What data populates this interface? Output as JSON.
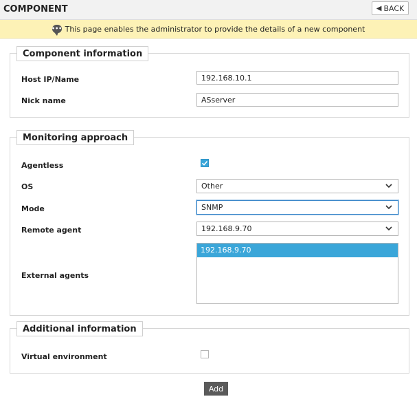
{
  "header": {
    "title": "COMPONENT",
    "back_label": "BACK"
  },
  "notice": {
    "text": "This page enables the administrator to provide the details of a new component"
  },
  "component_info": {
    "legend": "Component information",
    "host_label": "Host IP/Name",
    "host_value": "192.168.10.1",
    "nick_label": "Nick name",
    "nick_value": "ASserver"
  },
  "monitoring": {
    "legend": "Monitoring approach",
    "agentless_label": "Agentless",
    "agentless_checked": true,
    "os_label": "OS",
    "os_value": "Other",
    "mode_label": "Mode",
    "mode_value": "SNMP",
    "remote_label": "Remote agent",
    "remote_value": "192.168.9.70",
    "external_label": "External agents",
    "external_options": [
      "192.168.9.70"
    ]
  },
  "additional": {
    "legend": "Additional information",
    "virtual_label": "Virtual environment",
    "virtual_checked": false
  },
  "footer": {
    "add_label": "Add"
  },
  "colors": {
    "accent": "#3aa6d9",
    "notice_bg": "#fdf2b6",
    "add_button": "#5a5a5a"
  }
}
